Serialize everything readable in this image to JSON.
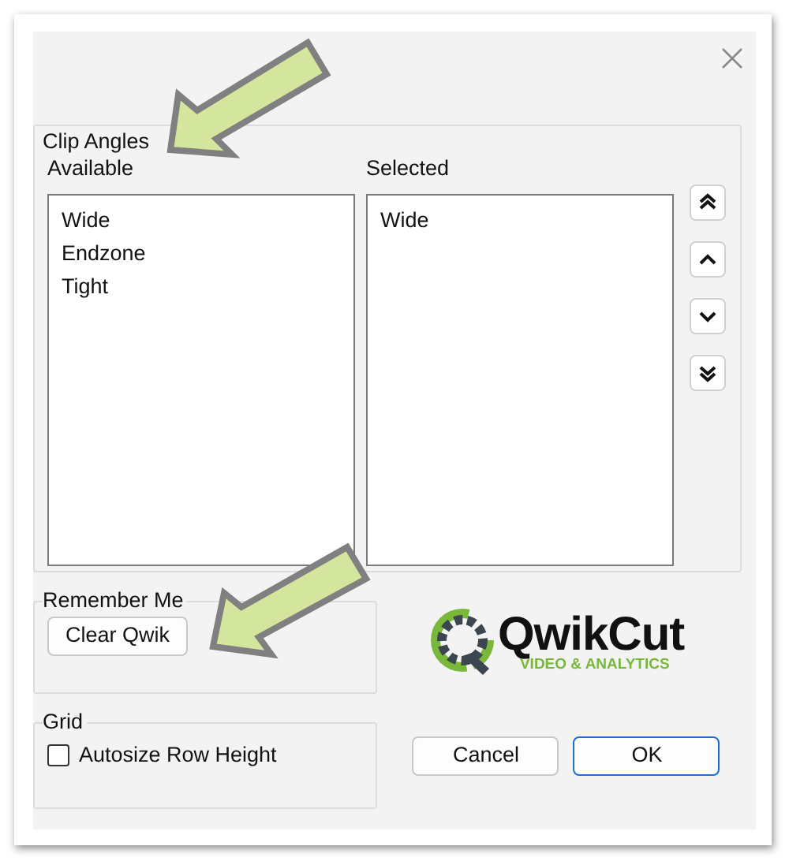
{
  "clip_angles": {
    "label": "Clip Angles",
    "available": {
      "label": "Available",
      "items": [
        "Wide",
        "Endzone",
        "Tight"
      ]
    },
    "selected": {
      "label": "Selected",
      "items": [
        "Wide"
      ]
    },
    "move_buttons": [
      {
        "kind": "top"
      },
      {
        "kind": "up"
      },
      {
        "kind": "down"
      },
      {
        "kind": "bottom"
      }
    ]
  },
  "remember_me": {
    "label": "Remember Me",
    "button": "Clear Qwik"
  },
  "logo": {
    "name": "QwikCut",
    "tagline": "VIDEO & ANALYTICS"
  },
  "grid": {
    "label": "Grid",
    "checkbox": {
      "label": "Autosize Row Height",
      "checked": false
    }
  },
  "buttons": [
    {
      "label": "Cancel",
      "default": false
    },
    {
      "label": "OK",
      "default": true
    }
  ]
}
